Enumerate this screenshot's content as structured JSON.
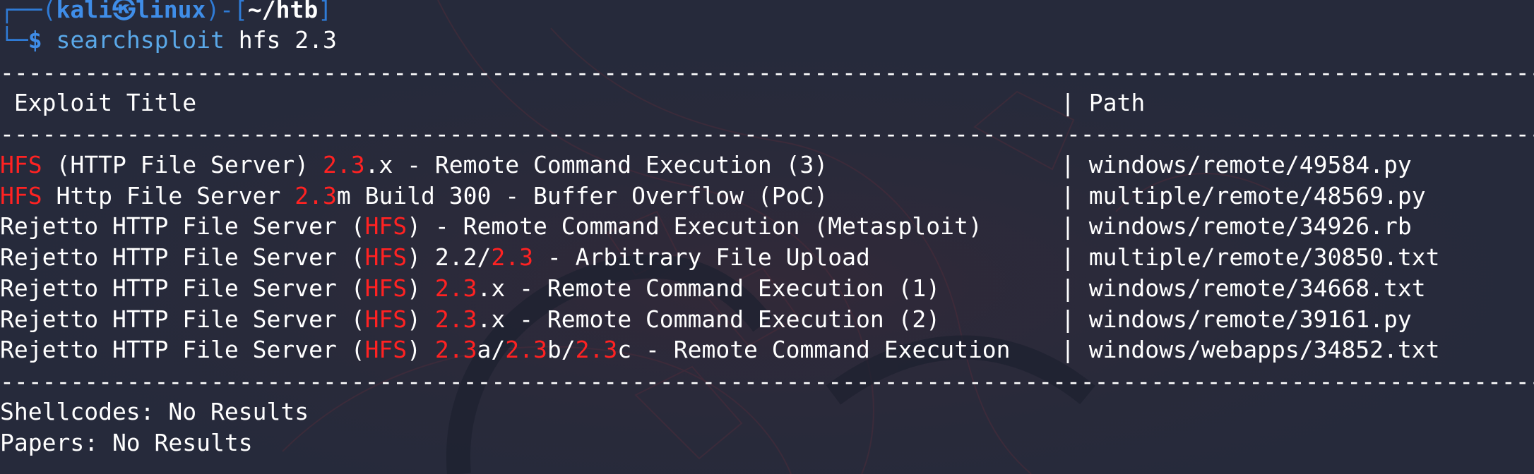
{
  "prompt": {
    "frame_start": "┌──(",
    "user": "kali",
    "at_icon": "㉿",
    "host": "linux",
    "frame_mid": ")-[",
    "dir": "~/htb",
    "frame_end": "]",
    "cmd_prefix": "└─",
    "dollar": "$",
    "command": "searchsploit",
    "args": "hfs 2.3"
  },
  "separator": {
    "left": "------------------------------------------------------------------------------------------------------------------------------------------------ ",
    "right": "----------------------------------------------------------------------"
  },
  "header": {
    "title": " Exploit Title",
    "pipe": "|",
    "path": " Path"
  },
  "results": [
    {
      "segments": [
        {
          "text": "HFS",
          "hl": true
        },
        {
          "text": " (HTTP File Server) ",
          "hl": false
        },
        {
          "text": "2.3",
          "hl": true
        },
        {
          "text": ".x - Remote Command Execution (3)",
          "hl": false
        }
      ],
      "path": "windows/remote/49584.py"
    },
    {
      "segments": [
        {
          "text": "HFS",
          "hl": true
        },
        {
          "text": " Http File Server ",
          "hl": false
        },
        {
          "text": "2.3",
          "hl": true
        },
        {
          "text": "m Build 300 - Buffer Overflow (PoC)",
          "hl": false
        }
      ],
      "path": "multiple/remote/48569.py"
    },
    {
      "segments": [
        {
          "text": "Rejetto HTTP File Server (",
          "hl": false
        },
        {
          "text": "HFS",
          "hl": true
        },
        {
          "text": ") - Remote Command Execution (Metasploit)",
          "hl": false
        }
      ],
      "path": "windows/remote/34926.rb"
    },
    {
      "segments": [
        {
          "text": "Rejetto HTTP File Server (",
          "hl": false
        },
        {
          "text": "HFS",
          "hl": true
        },
        {
          "text": ") 2.2/",
          "hl": false
        },
        {
          "text": "2.3",
          "hl": true
        },
        {
          "text": " - Arbitrary File Upload",
          "hl": false
        }
      ],
      "path": "multiple/remote/30850.txt"
    },
    {
      "segments": [
        {
          "text": "Rejetto HTTP File Server (",
          "hl": false
        },
        {
          "text": "HFS",
          "hl": true
        },
        {
          "text": ") ",
          "hl": false
        },
        {
          "text": "2.3",
          "hl": true
        },
        {
          "text": ".x - Remote Command Execution (1)",
          "hl": false
        }
      ],
      "path": "windows/remote/34668.txt"
    },
    {
      "segments": [
        {
          "text": "Rejetto HTTP File Server (",
          "hl": false
        },
        {
          "text": "HFS",
          "hl": true
        },
        {
          "text": ") ",
          "hl": false
        },
        {
          "text": "2.3",
          "hl": true
        },
        {
          "text": ".x - Remote Command Execution (2)",
          "hl": false
        }
      ],
      "path": "windows/remote/39161.py"
    },
    {
      "segments": [
        {
          "text": "Rejetto HTTP File Server (",
          "hl": false
        },
        {
          "text": "HFS",
          "hl": true
        },
        {
          "text": ") ",
          "hl": false
        },
        {
          "text": "2.3",
          "hl": true
        },
        {
          "text": "a/",
          "hl": false
        },
        {
          "text": "2.3",
          "hl": true
        },
        {
          "text": "b/",
          "hl": false
        },
        {
          "text": "2.3",
          "hl": true
        },
        {
          "text": "c - Remote Command Execution",
          "hl": false
        }
      ],
      "path": "windows/webapps/34852.txt"
    }
  ],
  "pipe": "|",
  "footer": {
    "shellcodes": "Shellcodes: No Results",
    "papers": "Papers: No Results"
  },
  "colors": {
    "background": "#262a3b",
    "highlight": "#ff2222",
    "prompt_blue": "#3f8de8",
    "command_blue": "#5aa8e8",
    "text": "#ffffff"
  }
}
